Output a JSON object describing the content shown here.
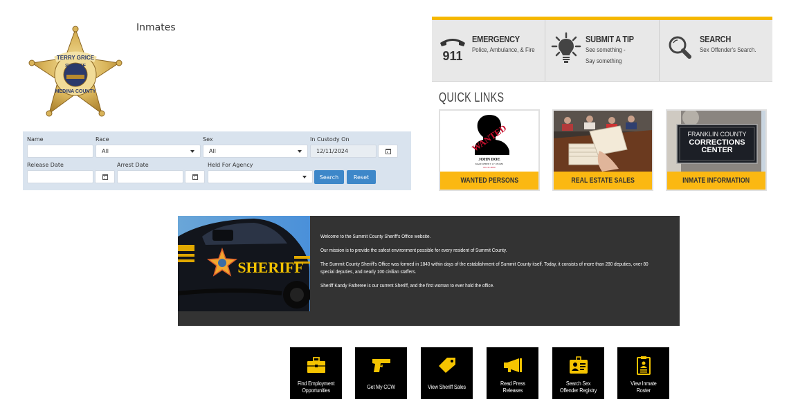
{
  "header": {
    "page_title": "Inmates",
    "badge": {
      "top_text": "TERRY GRICE",
      "middle_text": "SHERIFF",
      "bottom_text": "MEDINA COUNTY"
    }
  },
  "search_form": {
    "fields": {
      "name": {
        "label": "Name",
        "value": ""
      },
      "race": {
        "label": "Race",
        "value": "All"
      },
      "sex": {
        "label": "Sex",
        "value": "All"
      },
      "in_custody_on": {
        "label": "In Custody On",
        "value": "12/11/2024"
      },
      "release_date": {
        "label": "Release Date",
        "value": ""
      },
      "arrest_date": {
        "label": "Arrest Date",
        "value": ""
      },
      "held_for_agency": {
        "label": "Held For Agency",
        "value": ""
      }
    },
    "search_label": "Search",
    "reset_label": "Reset"
  },
  "info_bar": {
    "items": [
      {
        "title": "EMERGENCY",
        "sub1": "Police, Ambulance, & Fire",
        "sub2": "",
        "icon": "phone-911-icon",
        "icon_text": "911"
      },
      {
        "title": "SUBMIT A TIP",
        "sub1": "See something -",
        "sub2": "Say something",
        "icon": "lightbulb-icon"
      },
      {
        "title": "SEARCH",
        "sub1": "Sex Offender's Search.",
        "sub2": "",
        "icon": "magnifier-icon"
      }
    ],
    "accent": "#f5b800"
  },
  "quick_links": {
    "title": "QUICK LINKS",
    "items": [
      {
        "label": "WANTED PERSONS",
        "poster": {
          "stamp": "WANTED",
          "name": "JOHN DOE",
          "desc": "MALE WHITE 5' 11\" 185 LBS",
          "case": "00-CR-0000"
        }
      },
      {
        "label": "REAL ESTATE SALES"
      },
      {
        "label": "INMATE INFORMATION",
        "sign": {
          "line1": "FRANKLIN COUNTY",
          "line2": "CORRECTIONS",
          "line3": "CENTER"
        }
      }
    ],
    "accent": "#fbb812"
  },
  "welcome": {
    "car_text": "SHERIFF",
    "paragraphs": [
      "Welcome to the Summit County Sheriff's Office website.",
      "Our mission is to provide the safest environment possible for every resident of Summit County.",
      "The Summit County Sheriff's Office was formed in 1840 within days of the establishment of Summit County itself. Today, it consists of more than 280 deputies, over 80 special deputies, and nearly 100 civilian staffers.",
      "Sheriff Kandy Fatheree is our current Sheriff, and the first woman to ever hold the office."
    ]
  },
  "tiles": [
    {
      "line1": "Find Employment",
      "line2": "Opportunities",
      "icon": "briefcase-icon"
    },
    {
      "line1": "Get My CCW",
      "line2": "",
      "icon": "handgun-icon"
    },
    {
      "line1": "View Sheriff Sales",
      "line2": "",
      "icon": "price-tag-icon"
    },
    {
      "line1": "Read Press",
      "line2": "Releases",
      "icon": "megaphone-icon"
    },
    {
      "line1": "Search Sex",
      "line2": "Offender Registry",
      "icon": "id-badge-icon"
    },
    {
      "line1": "View Inmate",
      "line2": "Roster",
      "icon": "clipboard-icon"
    }
  ],
  "colors": {
    "tile_icon": "#f5c400",
    "button_blue": "#3d87c9",
    "form_bg": "#d9e3ee",
    "panel_dark": "#333333"
  }
}
